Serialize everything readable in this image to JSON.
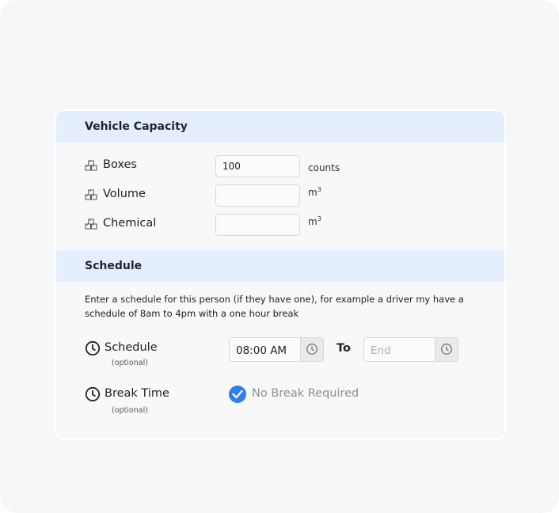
{
  "vehicle_capacity": {
    "title": "Vehicle Capacity",
    "rows": [
      {
        "label": "Boxes",
        "value": "100",
        "unit": "counts",
        "unit_sup": ""
      },
      {
        "label": "Volume",
        "value": "",
        "unit": "m",
        "unit_sup": "3"
      },
      {
        "label": "Chemical",
        "value": "",
        "unit": "m",
        "unit_sup": "3"
      }
    ],
    "row_icon": "boxes-icon"
  },
  "schedule": {
    "title": "Schedule",
    "description": "Enter a schedule for this person (if they have one), for example a driver my have a schedule of 8am to 4pm with a one hour break",
    "schedule_row": {
      "label": "Schedule",
      "optional": "(optional)",
      "start_value": "08:00 AM",
      "to_label": "To",
      "end_placeholder": "End"
    },
    "break_row": {
      "label": "Break Time",
      "optional": "(optional)",
      "checkbox_label": "No Break Required",
      "checked": true
    }
  },
  "colors": {
    "section_header_bg": "#e5eefc",
    "accent": "#2f7ef0"
  }
}
